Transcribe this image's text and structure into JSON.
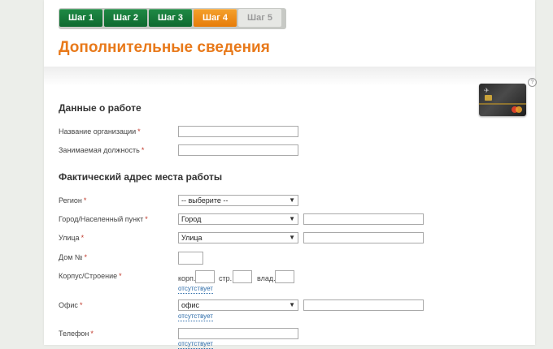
{
  "steps": [
    {
      "label": "Шаг 1",
      "state": "done"
    },
    {
      "label": "Шаг 2",
      "state": "done"
    },
    {
      "label": "Шаг 3",
      "state": "done"
    },
    {
      "label": "Шаг 4",
      "state": "active"
    },
    {
      "label": "Шаг 5",
      "state": "disabled"
    }
  ],
  "page_title": "Дополнительные сведения",
  "help_icon_text": "?",
  "work": {
    "title": "Данные о работе",
    "org_label": "Название организации",
    "position_label": "Занимаемая должность",
    "org_value": "",
    "position_value": ""
  },
  "address": {
    "title": "Фактический адрес места работы",
    "region_label": "Регион",
    "region_value": "-- выберите --",
    "city_label": "Город/Населенный пункт",
    "city_type": "Город",
    "street_label": "Улица",
    "street_type": "Улица",
    "house_label": "Дом №",
    "building_label": "Корпус/Строение",
    "korp": "корп.",
    "str": "стр.",
    "vlad": "влад.",
    "absent": "отсутствует",
    "office_label": "Офис",
    "office_type": "офис",
    "phone_label": "Телефон"
  },
  "required_mark": "*",
  "colors": {
    "step_done": "#0f6a30",
    "step_active": "#e67c0a",
    "title": "#e8791a",
    "link": "#2a6aa8"
  }
}
